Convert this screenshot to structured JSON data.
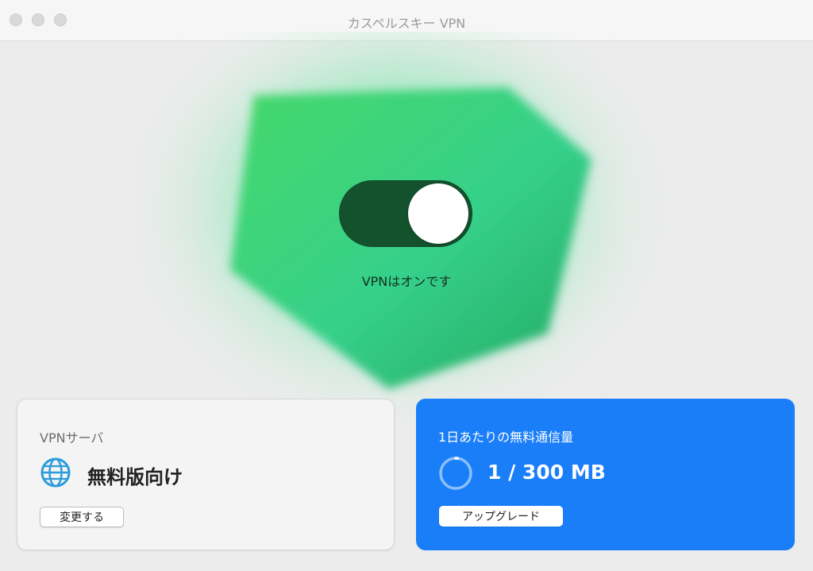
{
  "window": {
    "title": "カスペルスキー VPN"
  },
  "vpn": {
    "status_text": "VPNはオンです",
    "enabled": true
  },
  "server_card": {
    "label": "VPNサーバ",
    "server": "無料版向け",
    "icon": "globe-icon",
    "change_button": "変更する"
  },
  "traffic_card": {
    "label": "1日あたりの無料通信量",
    "usage": "1 / 300 MB",
    "used_mb": 1,
    "limit_mb": 300,
    "upgrade_button": "アップグレード"
  },
  "colors": {
    "toggle_on": "#14522e",
    "glow_green": "#2fc76a",
    "traffic_card_bg": "#1a7ef8",
    "globe_blue": "#2d9cdb"
  }
}
